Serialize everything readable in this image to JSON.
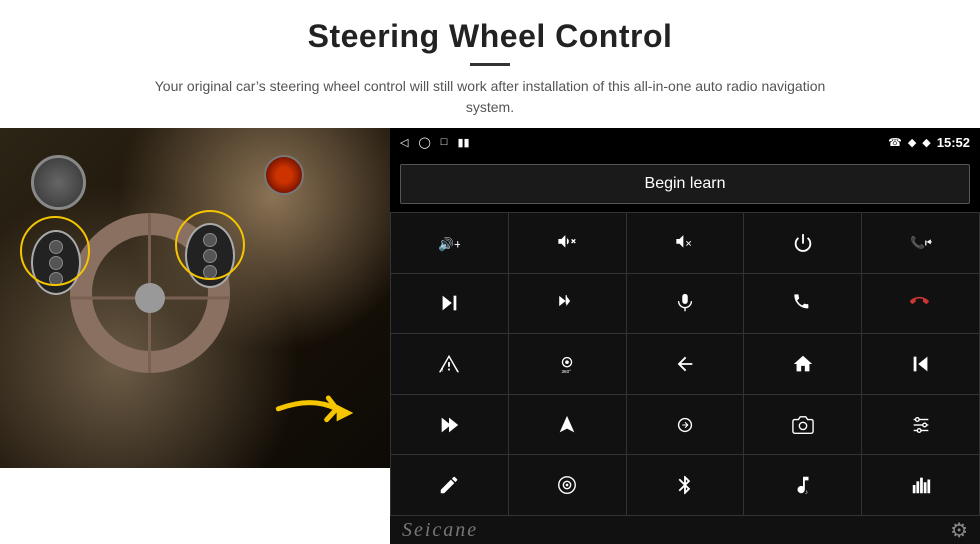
{
  "header": {
    "title": "Steering Wheel Control",
    "subtitle": "Your original car’s steering wheel control will still work after installation of this all-in-one auto radio navigation system."
  },
  "screen": {
    "status_bar": {
      "time": "15:52",
      "icons": [
        "back-arrow",
        "home-circle",
        "square-icon",
        "signal-icon"
      ]
    },
    "begin_learn_button": "Begin learn",
    "controls": [
      {
        "icon": "vol-up-icon",
        "symbol": "🔊+"
      },
      {
        "icon": "vol-down-icon",
        "symbol": "🔊-"
      },
      {
        "icon": "vol-mute-icon",
        "symbol": "🔇"
      },
      {
        "icon": "power-icon",
        "symbol": "⏻"
      },
      {
        "icon": "call-prev-icon",
        "symbol": "📞⏮"
      },
      {
        "icon": "next-track-icon",
        "symbol": "⏭"
      },
      {
        "icon": "shuffle-icon",
        "symbol": "⇌⏭"
      },
      {
        "icon": "mic-icon",
        "symbol": "🎤"
      },
      {
        "icon": "phone-icon",
        "symbol": "📞"
      },
      {
        "icon": "hang-up-icon",
        "symbol": "📵"
      },
      {
        "icon": "mute-car-icon",
        "symbol": "🔕"
      },
      {
        "icon": "360-icon",
        "symbol": "👁"
      },
      {
        "icon": "back-icon",
        "symbol": "↩"
      },
      {
        "icon": "home-icon",
        "symbol": "🏠"
      },
      {
        "icon": "skip-back-icon",
        "symbol": "⏮"
      },
      {
        "icon": "fast-forward-icon",
        "symbol": "⏩"
      },
      {
        "icon": "nav-icon",
        "symbol": "▶"
      },
      {
        "icon": "eq-icon",
        "symbol": "⇌"
      },
      {
        "icon": "camera-icon",
        "symbol": "📷"
      },
      {
        "icon": "settings-sliders",
        "symbol": "🎚"
      },
      {
        "icon": "pen-icon",
        "symbol": "✏"
      },
      {
        "icon": "radio-icon",
        "symbol": "🔘"
      },
      {
        "icon": "bluetooth-icon",
        "symbol": "⚡"
      },
      {
        "icon": "music-icon",
        "symbol": "♪"
      },
      {
        "icon": "eq2-icon",
        "symbol": "📊"
      }
    ],
    "watermark": "Seicane",
    "gear_icon": "⚙"
  }
}
